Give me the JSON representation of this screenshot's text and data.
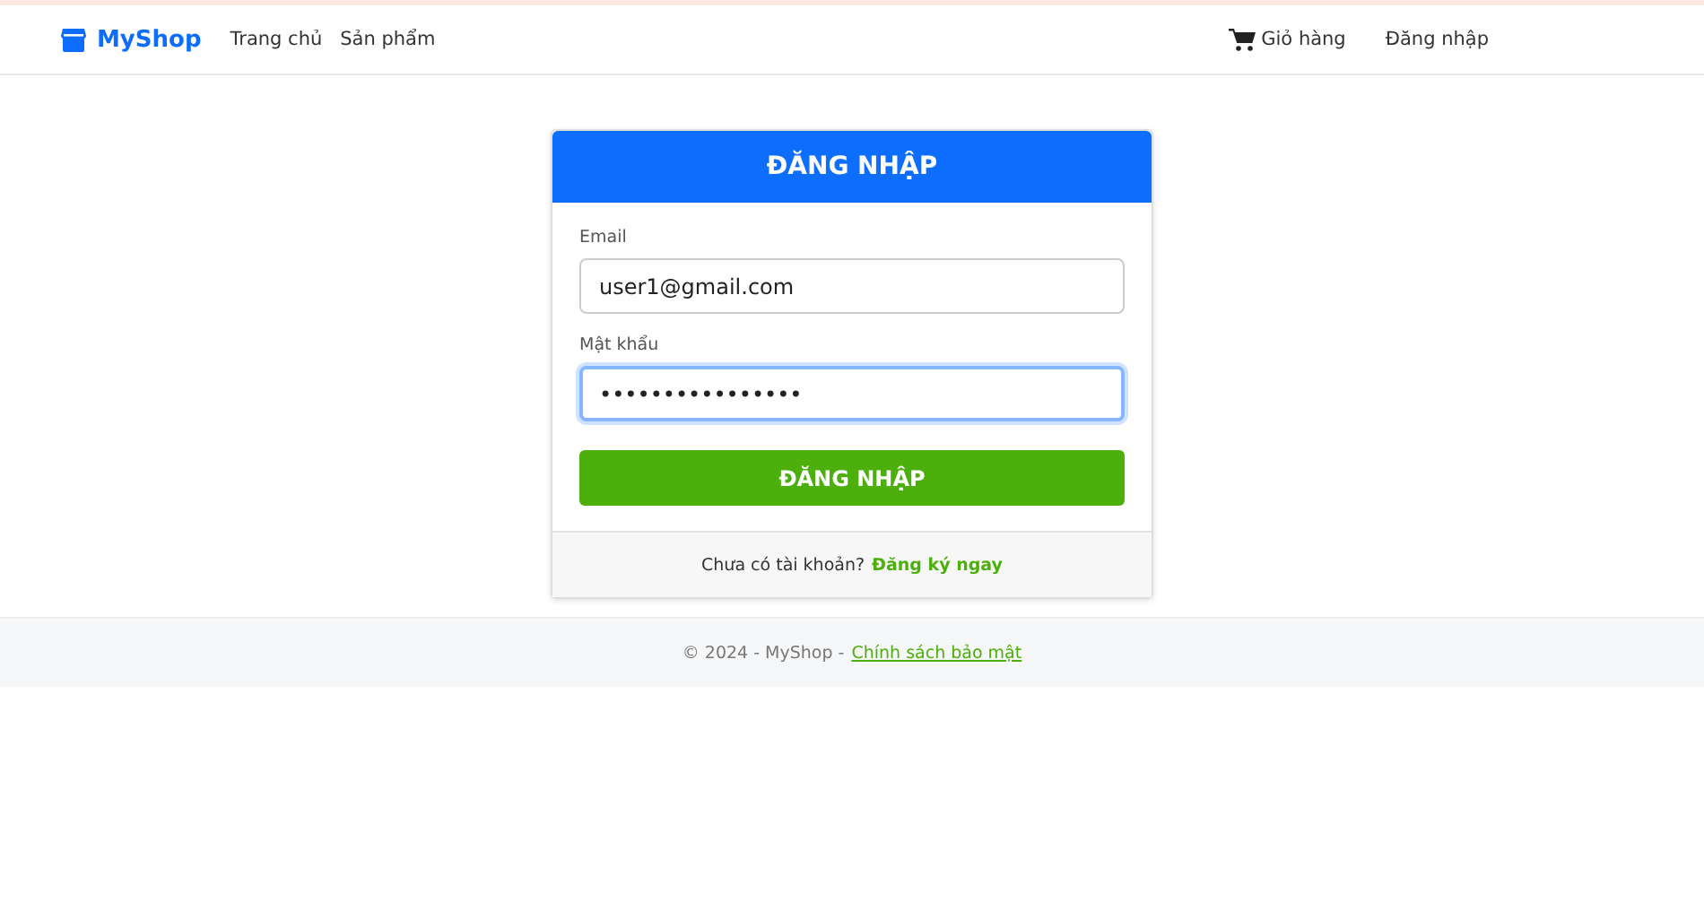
{
  "navbar": {
    "brand": "MyShop",
    "links": [
      "Trang chủ",
      "Sản phẩm"
    ],
    "cart": "Giỏ hàng",
    "login": "Đăng nhập"
  },
  "login_card": {
    "title": "ĐĂNG NHẬP",
    "fields": [
      {
        "label": "Email",
        "value": "user1@gmail.com",
        "focused": false
      },
      {
        "label": "Mật khẩu",
        "value": "••••••••••••••••",
        "focused": true
      }
    ],
    "submit": "ĐĂNG NHẬP",
    "footer_text": "Chưa có tài khoản?",
    "footer_link": "Đăng ký ngay"
  },
  "footer": {
    "text": "© 2024 - MyShop -",
    "link": "Chính sách bảo mật"
  }
}
